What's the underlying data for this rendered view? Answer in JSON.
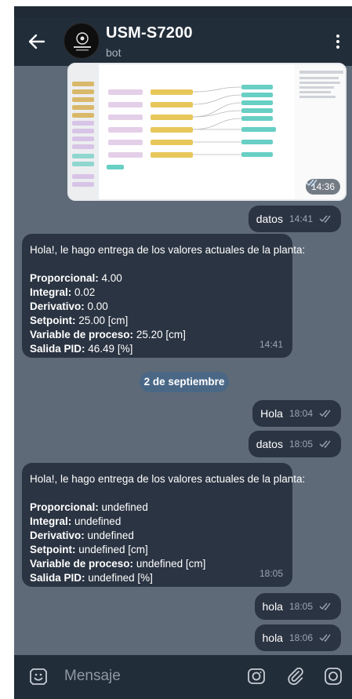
{
  "header": {
    "title": "USM-S7200",
    "subtitle": "bot"
  },
  "messages": {
    "image": {
      "time": "14:36"
    },
    "datos1": {
      "text": "datos",
      "time": "14:41"
    },
    "reply1": {
      "intro": "Hola!, le hago entrega de los valores actuales de la planta:",
      "rows": [
        {
          "label": "Proporcional:",
          "value": " 4.00"
        },
        {
          "label": "Integral:",
          "value": " 0.02"
        },
        {
          "label": "Derivativo:",
          "value": " 0.00"
        },
        {
          "label": "Setpoint:",
          "value": " 25.00 [cm]"
        },
        {
          "label": "Variable de proceso:",
          "value": " 25.20 [cm]"
        },
        {
          "label": "Salida PID:",
          "value": " 46.49 [%]"
        }
      ],
      "time": "14:41"
    },
    "date_separator": "2 de septiembre",
    "hola1": {
      "text": "Hola",
      "time": "18:04"
    },
    "datos2": {
      "text": "datos",
      "time": "18:05"
    },
    "reply2": {
      "intro": "Hola!, le hago entrega de los valores actuales de la planta:",
      "rows": [
        {
          "label": "Proporcional:",
          "value": " undefined"
        },
        {
          "label": "Integral:",
          "value": " undefined"
        },
        {
          "label": "Derivativo:",
          "value": " undefined"
        },
        {
          "label": "Setpoint:",
          "value": " undefined [cm]"
        },
        {
          "label": "Variable de proceso:",
          "value": " undefined [cm]"
        },
        {
          "label": "Salida PID:",
          "value": " undefined [%]"
        }
      ],
      "time": "18:05"
    },
    "hola2": {
      "text": "hola",
      "time": "18:05"
    },
    "hola3": {
      "text": "hola",
      "time": "18:06"
    }
  },
  "input": {
    "placeholder": "Mensaje"
  },
  "icons": {
    "back": "arrow-left-icon",
    "menu": "more-vertical-icon",
    "emoji": "emoji-icon",
    "camera": "camera-icon",
    "attach": "paperclip-icon",
    "mic": "record-icon"
  },
  "colors": {
    "chat_background": "#5e6a78",
    "bubble": "#2b3442",
    "appbar": "#222d3a",
    "date_pill": "#4a6886"
  }
}
